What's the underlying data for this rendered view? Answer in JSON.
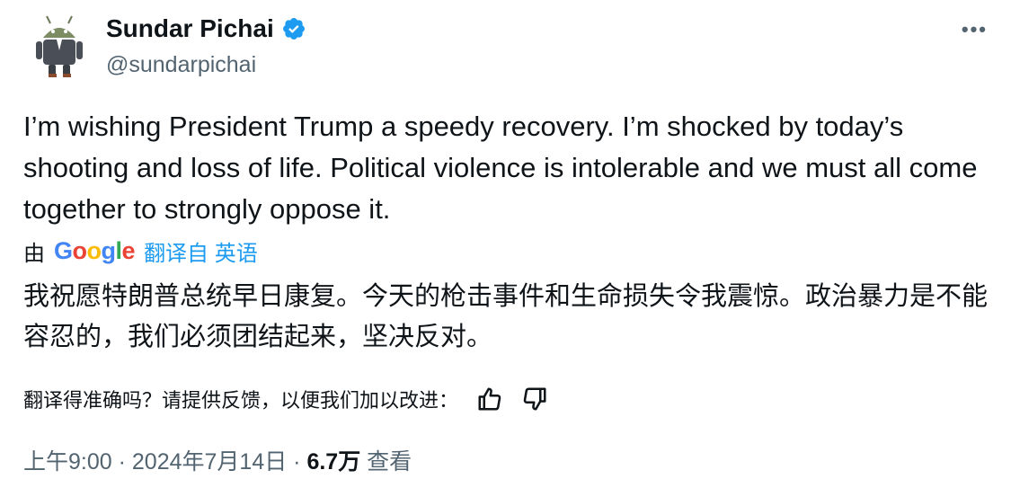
{
  "author": {
    "name": "Sundar Pichai",
    "handle": "@sundarpichai"
  },
  "more_label": "•••",
  "tweet": {
    "text": "I’m wishing President Trump a speedy recovery. I’m shocked by today’s shooting and loss of life. Political violence is intolerable and we must all come together to strongly oppose it."
  },
  "translation": {
    "by_label": "由",
    "google_letters": [
      "G",
      "o",
      "o",
      "g",
      "l",
      "e"
    ],
    "link_label": "翻译自 英语",
    "text": "我祝愿特朗普总统早日康复。今天的枪击事件和生命损失令我震惊。政治暴力是不能容忍的，我们必须团结起来，坚决反对。",
    "feedback_prompt": "翻译得准确吗？请提供反馈，以便我们加以改进："
  },
  "meta": {
    "time": "上午9:00",
    "separator": " · ",
    "date": "2024年7月14日",
    "views_count": "6.7万",
    "views_label": "查看"
  },
  "colors": {
    "link": "#1d9bf0",
    "secondary": "#536471",
    "verified": "#1d9bf0"
  }
}
